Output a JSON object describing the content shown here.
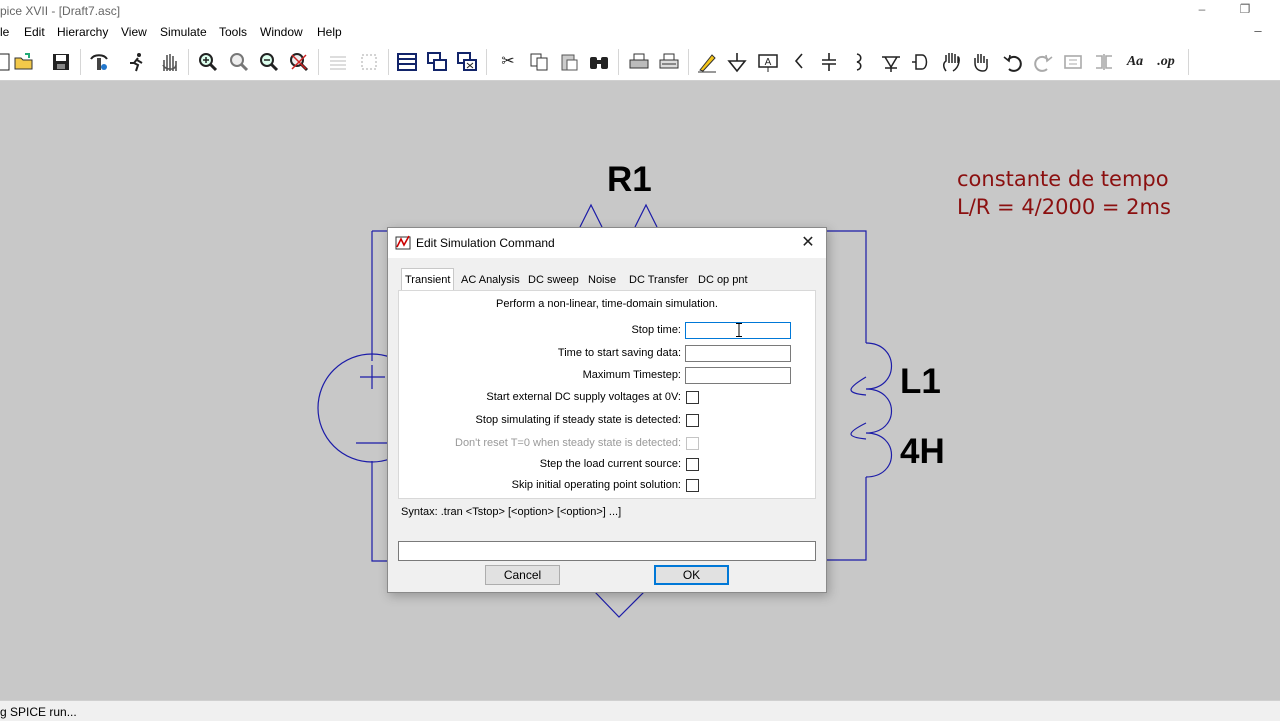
{
  "window": {
    "title": "pice XVII - [Draft7.asc]",
    "minimize_glyph": "–",
    "restore_glyph": "❐",
    "mdi_minimize_glyph": "–"
  },
  "menu": [
    "le",
    "Edit",
    "Hierarchy",
    "View",
    "Simulate",
    "Tools",
    "Window",
    "Help"
  ],
  "toolbar": {
    "icons": [
      "new-icon",
      "open-icon",
      "save-icon",
      "control-panel-icon",
      "run-icon",
      "halt-icon",
      "zoom-in-icon",
      "pan-icon",
      "zoom-out-icon",
      "zoom-cancel-icon",
      "autorange-icon",
      "zoom-area-icon",
      "tile-icon",
      "cascade-icon",
      "close-all-icon",
      "cut-icon",
      "copy-icon",
      "paste-icon",
      "find-icon",
      "print-icon",
      "print-preview-icon",
      "draw-wire-icon",
      "ground-icon",
      "label-net-icon",
      "resistor-icon",
      "capacitor-icon",
      "inductor-icon",
      "diode-icon",
      "component-icon",
      "move-icon",
      "drag-icon",
      "undo-icon",
      "redo-icon",
      "rotate-icon",
      "mirror-icon",
      "text-icon",
      "spice-directive-icon"
    ],
    "text_label": "Aa",
    "directive_label": ".op"
  },
  "schematic": {
    "r1_label": "R1",
    "l1_label": "L1",
    "l1_value": "4H",
    "note_line1": "constante de tempo",
    "note_line2": "L/R = 4/2000 = 2ms",
    "wire_color": "#1c1ca8",
    "note_color": "#8b1010"
  },
  "dialog": {
    "title": "Edit Simulation Command",
    "close_glyph": "✕",
    "tabs": [
      "Transient",
      "AC Analysis",
      "DC sweep",
      "Noise",
      "DC Transfer",
      "DC op pnt"
    ],
    "active_tab": "Transient",
    "description": "Perform a non-linear, time-domain simulation.",
    "fields": [
      {
        "label": "Stop time:",
        "value": ""
      },
      {
        "label": "Time to start saving data:",
        "value": ""
      },
      {
        "label": "Maximum Timestep:",
        "value": ""
      }
    ],
    "checkboxes": [
      {
        "label": "Start external DC supply voltages at 0V:",
        "checked": false,
        "enabled": true
      },
      {
        "label": "Stop simulating if steady state is detected:",
        "checked": false,
        "enabled": true
      },
      {
        "label": "Don't reset T=0 when steady state is detected:",
        "checked": false,
        "enabled": false
      },
      {
        "label": "Step the load current source:",
        "checked": false,
        "enabled": true
      },
      {
        "label": "Skip initial operating point solution:",
        "checked": false,
        "enabled": true
      }
    ],
    "syntax": "Syntax:  .tran <Tstop> [<option> [<option>] ...]",
    "command_line": "",
    "cancel_label": "Cancel",
    "ok_label": "OK"
  },
  "status": {
    "text": "g SPICE run..."
  }
}
